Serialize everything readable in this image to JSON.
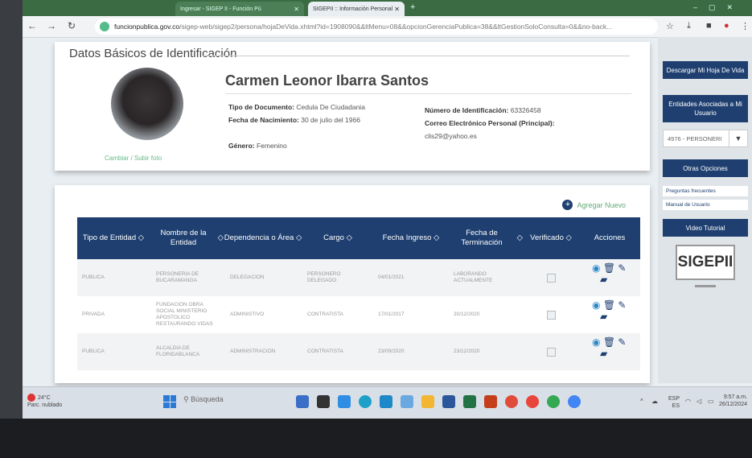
{
  "browser": {
    "tabs": [
      {
        "label": "Ingresar - SIGEP II - Función Pú"
      },
      {
        "label": "SIGEPII :: Información Personal"
      }
    ],
    "url_domain": "funcionpublica.gov.co",
    "url_path": "/sigep-web/sigep2/persona/hojaDeVida.xhtml?id=1908090&&ltMenu=08&&opcionGerenciaPublica=38&&ltGestionSoloConsulta=0&&no-back...",
    "icons": [
      "back-arrow-icon",
      "forward-arrow-icon",
      "reload-icon",
      "site-info-icon",
      "star-icon",
      "download-icon",
      "extension-icon",
      "profile-icon",
      "menu-icon"
    ]
  },
  "profile": {
    "section_title": "Datos Básicos de Identificación",
    "full_name": "Carmen Leonor Ibarra Santos",
    "change_photo_label": "Cambiar / Subir foto",
    "doc_type_label": "Tipo de Documento:",
    "doc_type_value": "Cedula De Ciudadania",
    "birth_label": "Fecha de Nacimiento:",
    "birth_value": "30 de julio del 1966",
    "gender_label": "Género:",
    "gender_value": "Femenino",
    "id_number_label": "Número de Identificación:",
    "id_number_value": "63326458",
    "email_label": "Correo Electrónico Personal (Principal):",
    "email_value": "clis29@yahoo.es"
  },
  "entities": {
    "add_new_label": "Agregar Nuevo",
    "columns": [
      "Tipo de Entidad",
      "Nombre de la Entidad",
      "Dependencia o Área",
      "Cargo",
      "Fecha Ingreso",
      "Fecha de Terminación",
      "Verificado",
      "Acciones"
    ],
    "rows": [
      {
        "tipo": "PUBLICA",
        "nombre": "PERSONERIA DE BUCARAMANGA",
        "dependencia": "DELEGACION",
        "cargo": "PERSONERO DELEGADO",
        "ingreso": "04/01/2021",
        "terminacion": "LABORANDO ACTUALMENTE"
      },
      {
        "tipo": "PRIVADA",
        "nombre": "FUNDACION OBRA SOCIAL MINISTERIO APOSTOLICO RESTAURANDO VIDAS",
        "dependencia": "ADMINISTIVO",
        "cargo": "CONTRATISTA",
        "ingreso": "17/01/2017",
        "terminacion": "30/12/2020"
      },
      {
        "tipo": "PUBLICA",
        "nombre": "ALCALDIA DE FLORIDABLANCA",
        "dependencia": "ADMINISTRACION",
        "cargo": "CONTRATISTA",
        "ingreso": "23/09/2020",
        "terminacion": "23/12/2020"
      }
    ]
  },
  "sidebar": {
    "download_label": "Descargar Mi Hoja De Vida",
    "entities_label": "Entidades Asociadas a Mi Usuario",
    "entity_select": "4976 - PERSONERI",
    "other_options_label": "Otras Opciones",
    "faq_label": "Preguntas frecuentes",
    "manual_label": "Manual de Usuario",
    "video_label": "Video Tutorial",
    "logo_text": "SIGEPII"
  },
  "taskbar": {
    "temperature": "24°C",
    "weather": "Parc. nublado",
    "search_placeholder": "Búsqueda",
    "lang": "ESP",
    "lang_region": "ES",
    "time": "9:57 a.m.",
    "date": "26/12/2024"
  }
}
